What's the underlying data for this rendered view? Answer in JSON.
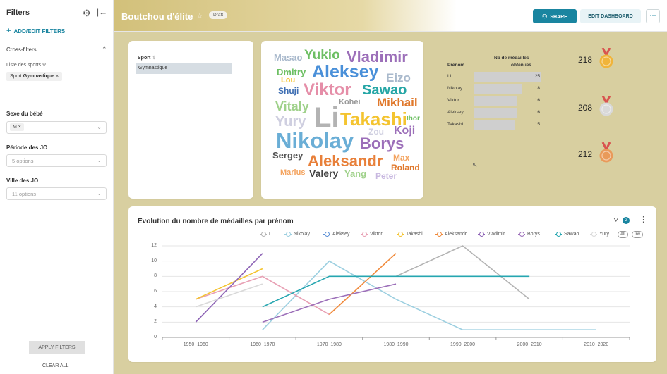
{
  "sidebar": {
    "title": "Filters",
    "add_filters": "ADD/EDIT FILTERS",
    "cross_filters": "Cross-filters",
    "cross_filter_source": "Liste des sports",
    "cross_filter_chip_key": "Sport",
    "cross_filter_chip_value": "Gymnastique",
    "filters": [
      {
        "label": "Sexe du bébé",
        "value_chip": "M",
        "placeholder": ""
      },
      {
        "label": "Période des JO",
        "placeholder": "5 options"
      },
      {
        "label": "Ville des JO",
        "placeholder": "11 options"
      }
    ],
    "apply": "APPLY FILTERS",
    "clear": "CLEAR ALL"
  },
  "header": {
    "title": "Boutchou d'élite",
    "status": "Draft",
    "share": "SHARE",
    "edit": "EDIT DASHBOARD",
    "more": "···"
  },
  "sport_table": {
    "header": "Sport",
    "rows": [
      "Gymnastique"
    ]
  },
  "wordcloud": [
    {
      "text": "Masao",
      "color": "#a9b9cc",
      "size": 13
    },
    {
      "text": "Yukio",
      "color": "#6dbf63",
      "size": 19
    },
    {
      "text": "Vladimir",
      "color": "#9c6fb9",
      "size": 22
    },
    {
      "text": "Dmitry",
      "color": "#6dbf63",
      "size": 13
    },
    {
      "text": "Aleksey",
      "color": "#4a90d9",
      "size": 25
    },
    {
      "text": "Lou",
      "color": "#f4c430",
      "size": 11
    },
    {
      "text": "Eizo",
      "color": "#a9b9cc",
      "size": 17
    },
    {
      "text": "Shuji",
      "color": "#3f6fb3",
      "size": 12
    },
    {
      "text": "Viktor",
      "color": "#e58ea8",
      "size": 24
    },
    {
      "text": "Sawao",
      "color": "#26a6a6",
      "size": 20
    },
    {
      "text": "Kohei",
      "color": "#999999",
      "size": 11
    },
    {
      "text": "Mikhail",
      "color": "#e0782b",
      "size": 17
    },
    {
      "text": "Vitaly",
      "color": "#9fd18a",
      "size": 18
    },
    {
      "text": "Li",
      "color": "#b3b3b3",
      "size": 40
    },
    {
      "text": "Takashi",
      "color": "#f4c430",
      "size": 26
    },
    {
      "text": "Ihor",
      "color": "#6dbf63",
      "size": 10
    },
    {
      "text": "Yury",
      "color": "#cfcfe0",
      "size": 20
    },
    {
      "text": "Zou",
      "color": "#cfcfe0",
      "size": 12
    },
    {
      "text": "Koji",
      "color": "#9c6fb9",
      "size": 16
    },
    {
      "text": "Nikolay",
      "color": "#6aaed6",
      "size": 31
    },
    {
      "text": "Borys",
      "color": "#9c6fb9",
      "size": 22
    },
    {
      "text": "Sergey",
      "color": "#555555",
      "size": 13
    },
    {
      "text": "Max",
      "color": "#f4a460",
      "size": 12
    },
    {
      "text": "Aleksandr",
      "color": "#e8803a",
      "size": 22
    },
    {
      "text": "Roland",
      "color": "#e0782b",
      "size": 12
    },
    {
      "text": "Marius",
      "color": "#f4a460",
      "size": 11
    },
    {
      "text": "Valery",
      "color": "#444444",
      "size": 14
    },
    {
      "text": "Yang",
      "color": "#9fd18a",
      "size": 13
    },
    {
      "text": "Peter",
      "color": "#c8b8e0",
      "size": 12
    }
  ],
  "medal_table": {
    "col1": "Prenom",
    "col2_line1": "Nb de médailles",
    "col2_line2": "obtenues",
    "rows": [
      {
        "name": "Li",
        "value": 25
      },
      {
        "name": "Nikolay",
        "value": 18
      },
      {
        "name": "Viktor",
        "value": 16
      },
      {
        "name": "Aleksey",
        "value": 16
      },
      {
        "name": "Takashi",
        "value": 15
      }
    ]
  },
  "kpis": [
    {
      "value": "218",
      "medal": "gold"
    },
    {
      "value": "208",
      "medal": "silver"
    },
    {
      "value": "212",
      "medal": "bronze"
    }
  ],
  "medal_colors": {
    "gold": "#f0b43a",
    "silver": "#d9d9d9",
    "bronze": "#e99a5a",
    "ribbon": "#d9534f"
  },
  "chart": {
    "filter_count": "2",
    "legend_extra": [
      "All",
      "Inv"
    ]
  },
  "chart_data": {
    "type": "line",
    "title": "Evolution du nombre de médailles par prénom",
    "categories": [
      "1950_1960",
      "1960_1970",
      "1970_1980",
      "1980_1990",
      "1990_2000",
      "2000_2010",
      "2010_2020"
    ],
    "ylim": [
      0,
      12
    ],
    "yticks": [
      0,
      2,
      4,
      6,
      8,
      10,
      12
    ],
    "series": [
      {
        "name": "Li",
        "color": "#b3b3b3",
        "points": [
          [
            3,
            8
          ],
          [
            4,
            12
          ],
          [
            5,
            5
          ]
        ]
      },
      {
        "name": "Nikolay",
        "color": "#9ccfe0",
        "points": [
          [
            1,
            1
          ],
          [
            2,
            10
          ],
          [
            3,
            5
          ],
          [
            4,
            1
          ],
          [
            6,
            1
          ]
        ]
      },
      {
        "name": "Aleksey",
        "color": "#5b8fd6",
        "points": []
      },
      {
        "name": "Viktor",
        "color": "#e8a0b4",
        "points": [
          [
            0,
            5
          ],
          [
            1,
            8
          ],
          [
            2,
            3
          ]
        ]
      },
      {
        "name": "Takashi",
        "color": "#f4c430",
        "points": [
          [
            0,
            5
          ],
          [
            1,
            9
          ]
        ]
      },
      {
        "name": "Aleksandr",
        "color": "#f08a3c",
        "points": [
          [
            2,
            3
          ],
          [
            3,
            11
          ]
        ]
      },
      {
        "name": "Vladimir",
        "color": "#8e65b6",
        "points": [
          [
            0,
            2
          ],
          [
            1,
            11
          ]
        ]
      },
      {
        "name": "Borys",
        "color": "#9c6fb9",
        "points": [
          [
            1,
            2
          ],
          [
            2,
            5
          ],
          [
            3,
            7
          ]
        ]
      },
      {
        "name": "Sawao",
        "color": "#26a6b0",
        "points": [
          [
            1,
            4
          ],
          [
            2,
            8
          ],
          [
            4,
            8
          ],
          [
            5,
            8
          ]
        ]
      },
      {
        "name": "Yury",
        "color": "#d9d9d9",
        "points": [
          [
            0,
            4
          ],
          [
            1,
            7
          ]
        ]
      }
    ],
    "grid": true,
    "legend": "top"
  }
}
